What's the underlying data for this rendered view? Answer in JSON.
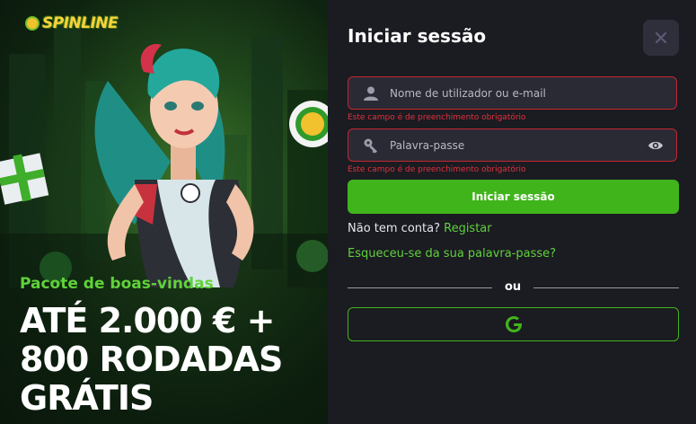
{
  "promo": {
    "logo_text": "SPINLINE",
    "subtitle": "Pacote de boas-vindas",
    "headline_line1": "ATÉ 2.000 € +",
    "headline_line2": "800 RODADAS",
    "headline_line3": "GRÁTIS"
  },
  "form": {
    "title": "Iniciar sessão",
    "username_placeholder": "Nome de utilizador ou e-mail",
    "username_value": "",
    "username_error": "Este campo é de preenchimento obrigatório",
    "password_placeholder": "Palavra-passe",
    "password_value": "",
    "password_error": "Este campo é de preenchimento obrigatório",
    "login_label": "Iniciar sessão",
    "no_account_text": "Não tem conta?",
    "register_label": "Registar",
    "forgot_label": "Esqueceu-se da sua palavra-passe?",
    "or_label": "ou"
  },
  "icons": {
    "close": "close-icon",
    "user": "user-icon",
    "key": "key-icon",
    "eye": "eye-icon",
    "google": "google-icon"
  },
  "colors": {
    "accent": "#40b51b",
    "link": "#5fd23a",
    "error": "#e0323b",
    "panel_bg": "#1b1b22",
    "field_bg": "#2a2a35"
  }
}
